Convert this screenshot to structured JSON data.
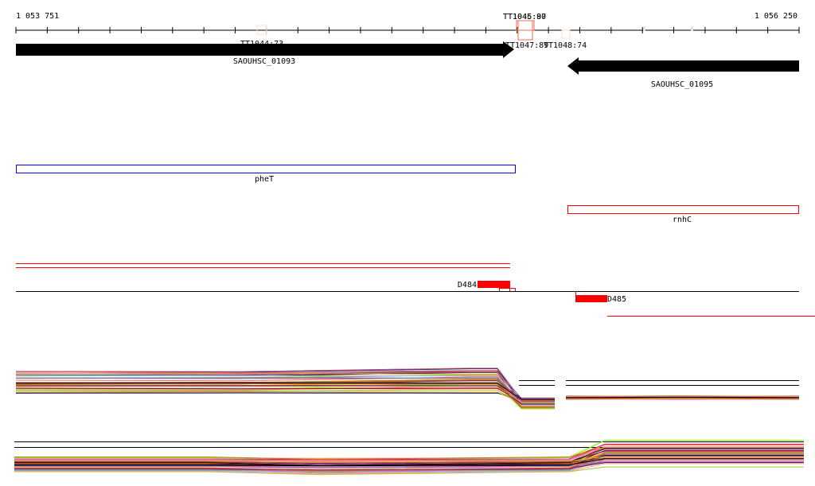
{
  "ruler": {
    "start_label": "1 053 751",
    "end_label": "1 056 250"
  },
  "terminators": [
    {
      "label": "TT1044:73",
      "color": "#f9dccf"
    },
    {
      "label": "TT1045:80",
      "color": "#f26b4f"
    },
    {
      "label": "TT1046:97",
      "color": "#f26b4f"
    },
    {
      "label": "TT1047:89",
      "color": "#f26b4f"
    },
    {
      "label": "TT1048:74",
      "color": "#f9dccf"
    }
  ],
  "genes": [
    {
      "label": "SAOUHSC_01093",
      "strand": "+"
    },
    {
      "label": "SAOUHSC_01095",
      "strand": "-"
    }
  ],
  "annotations": [
    {
      "label": "pheT",
      "color": "#0000ff"
    },
    {
      "label": "rnhC",
      "color": "#ff0000"
    }
  ],
  "features": [
    {
      "label": "D484",
      "color": "#ff0000"
    },
    {
      "label": "D485",
      "color": "#ff0000"
    }
  ],
  "track_colors": [
    "#808000",
    "#ff8c00",
    "#7cfc00",
    "#8b0000",
    "#c71585",
    "#ff6347",
    "#87cefa",
    "#000080",
    "#d2691e",
    "#ff69b4",
    "#daa520",
    "#9acd32",
    "#b8860b",
    "#cd5c5c",
    "#4682b4",
    "#800080",
    "#ffa07a",
    "#a0522d",
    "#db7093",
    "#000000"
  ]
}
